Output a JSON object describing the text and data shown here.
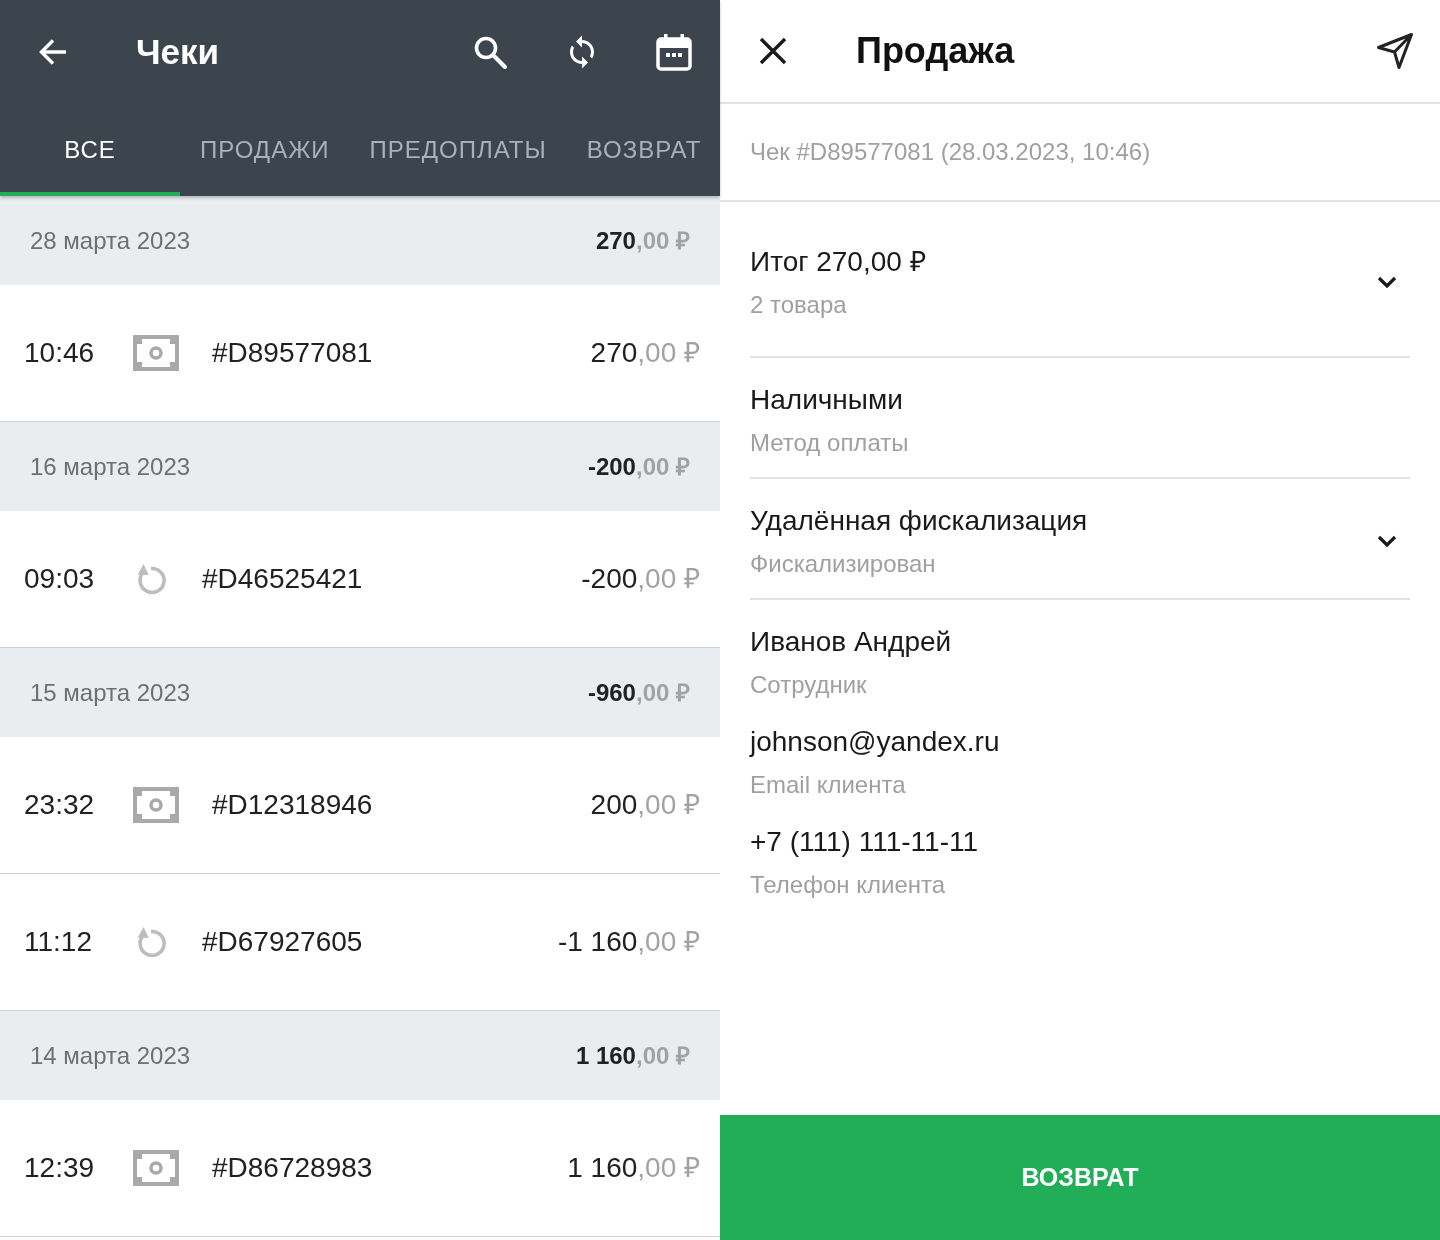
{
  "list_screen": {
    "title": "Чеки",
    "tabs": [
      {
        "label": "ВСЕ",
        "selected": true
      },
      {
        "label": "ПРОДАЖИ",
        "selected": false
      },
      {
        "label": "ПРЕДОПЛАТЫ",
        "selected": false
      },
      {
        "label": "ВОЗВРАТ",
        "selected": false
      }
    ],
    "days": [
      {
        "date": "28 марта 2023",
        "total": {
          "whole": "270",
          "fraction": ",00 ₽"
        },
        "receipts": [
          {
            "time": "10:46",
            "kind": "sale",
            "number": "#D89577081",
            "amount": {
              "whole": "270",
              "fraction": ",00 ₽"
            }
          }
        ]
      },
      {
        "date": "16 марта 2023",
        "total": {
          "whole": "-200",
          "fraction": ",00 ₽"
        },
        "receipts": [
          {
            "time": "09:03",
            "kind": "refund",
            "number": "#D46525421",
            "amount": {
              "whole": "-200",
              "fraction": ",00 ₽"
            }
          }
        ]
      },
      {
        "date": "15 марта 2023",
        "total": {
          "whole": "-960",
          "fraction": ",00 ₽"
        },
        "receipts": [
          {
            "time": "23:32",
            "kind": "sale",
            "number": "#D12318946",
            "amount": {
              "whole": "200",
              "fraction": ",00 ₽"
            }
          },
          {
            "time": "11:12",
            "kind": "refund",
            "number": "#D67927605",
            "amount": {
              "whole": "-1 160",
              "fraction": ",00 ₽"
            }
          }
        ]
      },
      {
        "date": "14 марта 2023",
        "total": {
          "whole": "1 160",
          "fraction": ",00 ₽"
        },
        "receipts": [
          {
            "time": "12:39",
            "kind": "sale",
            "number": "#D86728983",
            "amount": {
              "whole": "1 160",
              "fraction": ",00 ₽"
            }
          }
        ]
      }
    ]
  },
  "detail_screen": {
    "title": "Продажа",
    "caption": "Чек #D89577081 (28.03.2023, 10:46)",
    "groups": [
      {
        "items": [
          {
            "kind": "expandable",
            "value": "Итог 270,00 ₽",
            "label": "2 товара"
          }
        ]
      },
      {
        "items": [
          {
            "kind": "plain",
            "value": "Наличными",
            "label": "Метод оплаты"
          }
        ]
      },
      {
        "items": [
          {
            "kind": "expandable",
            "value": "Удалённая фискализация",
            "label": "Фискализирован"
          }
        ]
      },
      {
        "items": [
          {
            "kind": "plain",
            "value": "Иванов Андрей",
            "label": "Сотрудник"
          },
          {
            "kind": "plain",
            "value": "johnson@yandex.ru",
            "label": "Email клиента"
          },
          {
            "kind": "plain",
            "value": "+7 (111) 111-11-11",
            "label": "Телефон клиента"
          }
        ]
      }
    ],
    "action_button": "ВОЗВРАТ"
  }
}
